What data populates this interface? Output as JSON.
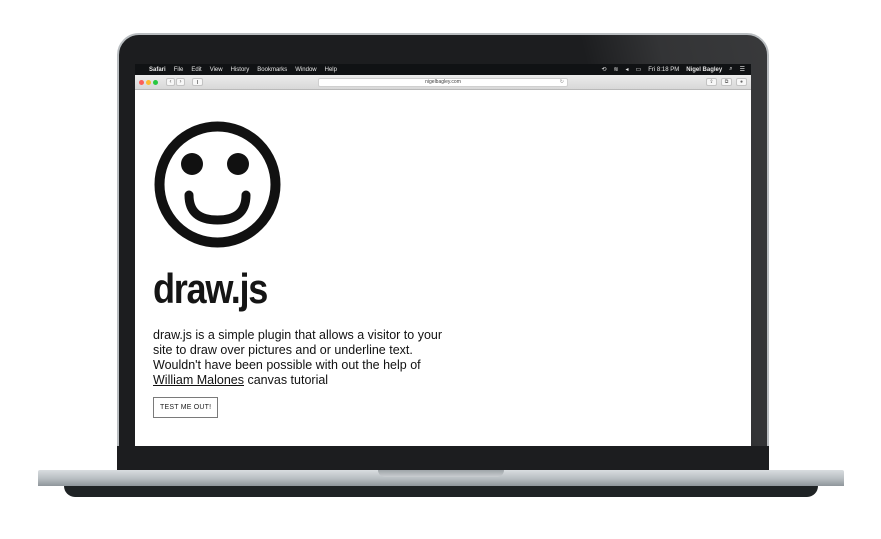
{
  "menubar": {
    "apple": "",
    "app_name": "Safari",
    "menus": [
      "File",
      "Edit",
      "View",
      "History",
      "Bookmarks",
      "Window",
      "Help"
    ],
    "clock": "Fri 8:18 PM",
    "user": "Nigel Bagley"
  },
  "browser": {
    "url": "nigelbagley.com"
  },
  "page": {
    "title": "draw.js",
    "description_before_link": "draw.js is a simple plugin that allows a visitor to your site to draw over pictures and or underline text. Wouldn't have been possible with out the help of ",
    "link_text": "William Malones",
    "description_after_link": " canvas tutorial",
    "button_label": "TEST ME OUT!"
  },
  "icons": {
    "logo": "smiley-face-icon"
  }
}
